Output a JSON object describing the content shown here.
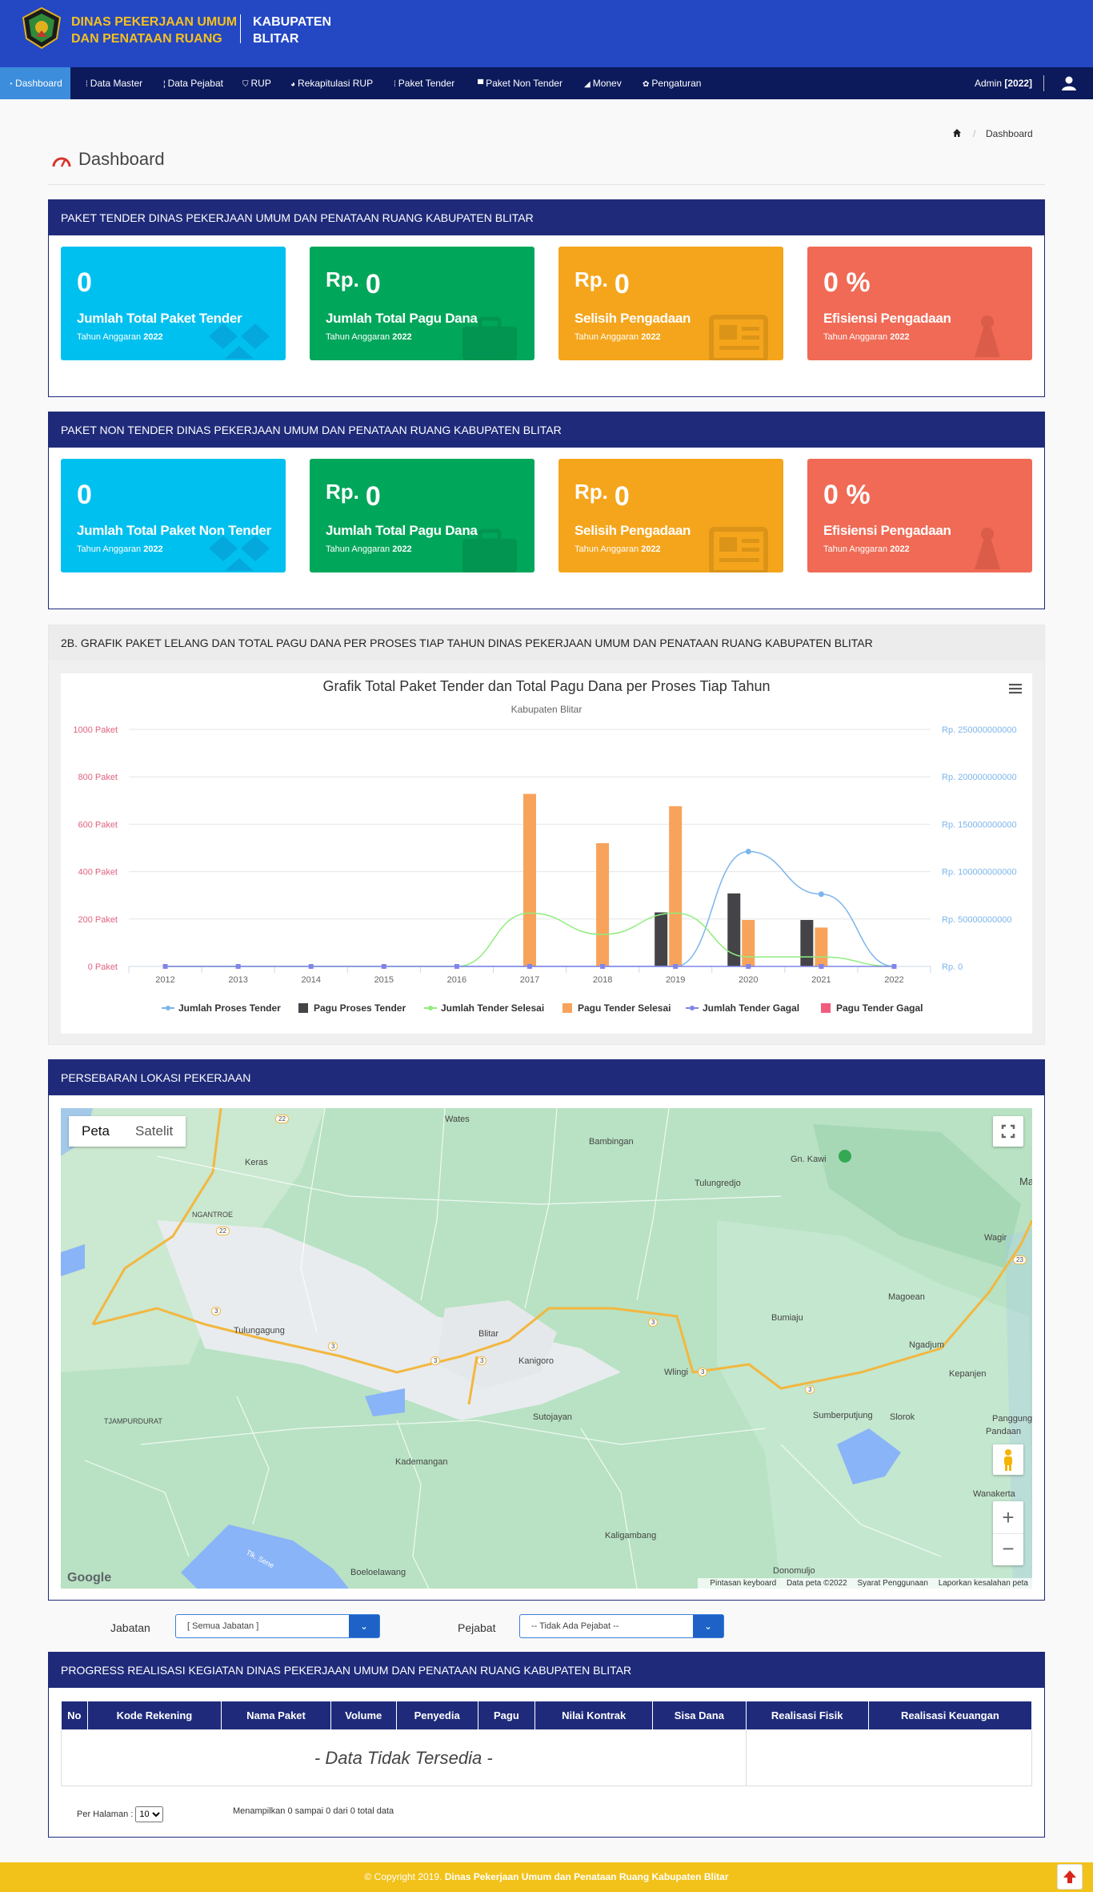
{
  "header": {
    "brand_line1": "DINAS PEKERJAAN UMUM",
    "brand_line2": "DAN PENATAAN RUANG",
    "region_line1": "KABUPATEN",
    "region_line2": "BLITAR",
    "nav": [
      {
        "label": "Dashboard",
        "icon": "speedometer-icon"
      },
      {
        "label": "Data Master",
        "icon": "grid-icon"
      },
      {
        "label": "Data Pejabat",
        "icon": "user-icon"
      },
      {
        "label": "RUP",
        "icon": "shield-icon"
      },
      {
        "label": "Rekapitulasi RUP",
        "icon": "pie-icon"
      },
      {
        "label": "Paket Tender",
        "icon": "grid-icon"
      },
      {
        "label": "Paket Non Tender",
        "icon": "doc-icon"
      },
      {
        "label": "Monev",
        "icon": "chart-icon"
      },
      {
        "label": "Pengaturan",
        "icon": "gear-icon"
      }
    ],
    "admin_label": "Admin",
    "admin_year": "[2022]"
  },
  "breadcrumb": {
    "current": "Dashboard"
  },
  "page_title": "Dashboard",
  "tender_panel": {
    "title": "PAKET TENDER DINAS PEKERJAAN UMUM DAN PENATAAN RUANG KABUPATEN BLITAR",
    "boxes": [
      {
        "prefix": "",
        "value": "0",
        "label": "Jumlah Total Paket Tender",
        "year_label": "Tahun Anggaran",
        "year": "2022"
      },
      {
        "prefix": "Rp.",
        "value": "0",
        "label": "Jumlah Total Pagu Dana",
        "year_label": "Tahun Anggaran",
        "year": "2022"
      },
      {
        "prefix": "Rp.",
        "value": "0",
        "label": "Selisih Pengadaan",
        "year_label": "Tahun Anggaran",
        "year": "2022"
      },
      {
        "prefix": "",
        "value": "0 %",
        "label": "Efisiensi Pengadaan",
        "year_label": "Tahun Anggaran",
        "year": "2022"
      }
    ]
  },
  "nontender_panel": {
    "title": "PAKET NON TENDER DINAS PEKERJAAN UMUM DAN PENATAAN RUANG KABUPATEN BLITAR",
    "boxes": [
      {
        "prefix": "",
        "value": "0",
        "label": "Jumlah Total Paket Non Tender",
        "year_label": "Tahun Anggaran",
        "year": "2022"
      },
      {
        "prefix": "Rp.",
        "value": "0",
        "label": "Jumlah Total Pagu Dana",
        "year_label": "Tahun Anggaran",
        "year": "2022"
      },
      {
        "prefix": "Rp.",
        "value": "0",
        "label": "Selisih Pengadaan",
        "year_label": "Tahun Anggaran",
        "year": "2022"
      },
      {
        "prefix": "",
        "value": "0 %",
        "label": "Efisiensi Pengadaan",
        "year_label": "Tahun Anggaran",
        "year": "2022"
      }
    ]
  },
  "chart_panel": {
    "title": "2B. GRAFIK PAKET LELANG DAN TOTAL PAGU DANA PER PROSES TIAP TAHUN DINAS PEKERJAAN UMUM DAN PENATAAN RUANG KABUPATEN BLITAR"
  },
  "chart_data": {
    "type": "bar",
    "title": "Grafik Total Paket Tender dan Total Pagu Dana per Proses Tiap Tahun",
    "subtitle": "Kabupaten Blitar",
    "categories": [
      "2012",
      "2013",
      "2014",
      "2015",
      "2016",
      "2017",
      "2018",
      "2019",
      "2020",
      "2021",
      "2022"
    ],
    "y_left": {
      "ticks": [
        "0 Paket",
        "200 Paket",
        "400 Paket",
        "600 Paket",
        "800 Paket",
        "1000 Paket"
      ],
      "range": [
        0,
        1000
      ],
      "color": "#e0637f"
    },
    "y_right": {
      "ticks": [
        "Rp. 0",
        "Rp. 50000000000",
        "Rp. 100000000000",
        "Rp. 150000000000",
        "Rp. 200000000000",
        "Rp. 250000000000"
      ],
      "range": [
        0,
        250000000000
      ],
      "color": "#7cb5ec"
    },
    "series": [
      {
        "name": "Jumlah Proses Tender",
        "kind": "spline",
        "axis": "left",
        "color": "#7cb5ec",
        "values": [
          0,
          0,
          0,
          0,
          0,
          0,
          0,
          0,
          485,
          305,
          0
        ]
      },
      {
        "name": "Pagu Proses Tender",
        "kind": "column",
        "axis": "right",
        "color": "#434348",
        "values": [
          0,
          0,
          0,
          0,
          0,
          0,
          0,
          57000000000,
          77000000000,
          49000000000,
          0
        ]
      },
      {
        "name": "Jumlah Tender Selesai",
        "kind": "spline",
        "axis": "left",
        "color": "#90ed7d",
        "values": [
          0,
          0,
          0,
          0,
          0,
          225,
          135,
          225,
          40,
          40,
          0
        ]
      },
      {
        "name": "Pagu Tender Selesai",
        "kind": "column",
        "axis": "right",
        "color": "#f7a35c",
        "values": [
          0,
          0,
          0,
          0,
          0,
          182000000000,
          130000000000,
          169000000000,
          49000000000,
          41000000000,
          0
        ]
      },
      {
        "name": "Jumlah Tender Gagal",
        "kind": "line",
        "axis": "left",
        "color": "#8085e9",
        "values": [
          0,
          0,
          0,
          0,
          0,
          0,
          0,
          0,
          0,
          0,
          0
        ]
      },
      {
        "name": "Pagu Tender Gagal",
        "kind": "column",
        "axis": "right",
        "color": "#f15c80",
        "values": [
          0,
          0,
          0,
          0,
          0,
          0,
          0,
          0,
          0,
          0,
          0
        ]
      }
    ],
    "grid": true,
    "legend_position": "bottom"
  },
  "map_panel": {
    "title": "PERSEBARAN lOKASI PEKERJAAN",
    "type_map": "Peta",
    "type_sat": "Satelit",
    "labels": [
      "Wates",
      "Bambingan",
      "Keras",
      "Gn. Kawi",
      "Tulungredjo",
      "NGANTROE",
      "Wagir",
      "Magoean",
      "Tulungagung",
      "Bumiaju",
      "Blitar",
      "Kanigoro",
      "Wlingi",
      "Ngadjum",
      "Kepanjen",
      "TJAMPURDURAT",
      "Sutojayan",
      "Sumberputjung",
      "Slorok",
      "Panggung",
      "Pandaan",
      "Kademangan",
      "Wanakerta",
      "Kaligambang",
      "Donomuljo",
      "Boeloelawang",
      "Tlk. Sene",
      "Ma"
    ],
    "road_numbers": [
      "22",
      "22",
      "3",
      "3",
      "3",
      "3",
      "3",
      "3",
      "3",
      "23"
    ],
    "footer": [
      "Pintasan keyboard",
      "Data peta ©2022",
      "Syarat Penggunaan",
      "Laporkan kesalahan peta"
    ],
    "google": "Google"
  },
  "filters": {
    "jabatan_label": "Jabatan",
    "jabatan_value": "[ Semua Jabatan ]",
    "pejabat_label": "Pejabat",
    "pejabat_value": "-- Tidak Ada Pejabat --"
  },
  "progress_panel": {
    "title": "PROGRESS REALISASI KEGIATAN DINAS PEKERJAAN UMUM DAN PENATAAN RUANG KABUPATEN BLITAR",
    "columns": [
      "No",
      "Kode Rekening",
      "Nama Paket",
      "Volume",
      "Penyedia",
      "Pagu",
      "Nilai Kontrak",
      "Sisa Dana",
      "Realisasi Fisik",
      "Realisasi Keuangan"
    ],
    "empty": "- Data Tidak Tersedia -",
    "per_page_label": "Per Halaman :",
    "per_page_value": "10",
    "info": "Menampilkan 0 sampai 0 dari 0 total data"
  },
  "footer": {
    "copyright": "© Copyright 2019.",
    "owner": "Dinas Pekerjaan Umum dan Penataan Ruang Kabupaten Blitar"
  }
}
